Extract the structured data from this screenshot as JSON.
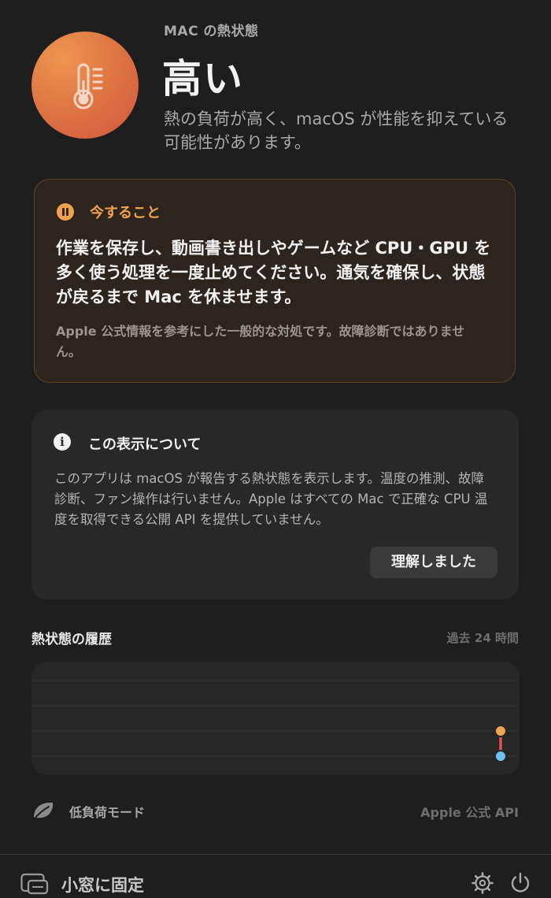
{
  "header": {
    "eyebrow": "MAC の熱状態",
    "status": "高い",
    "description": "熱の負荷が高く、macOS が性能を抑えている可能性があります。",
    "icon": "thermometer-icon",
    "accent": "#e07a44"
  },
  "action_card": {
    "heading": "今すること",
    "icon": "pause-circle-icon",
    "body": "作業を保存し、動画書き出しやゲームなど CPU・GPU を多く使う処理を一度止めてください。通気を確保し、状態が戻るまで Mac を休ませます。",
    "note": "Apple 公式情報を参考にした一般的な対処です。故障診断ではありません。",
    "accent": "#f0a24e"
  },
  "info_card": {
    "heading": "この表示について",
    "icon": "info-circle-icon",
    "body": "このアプリは macOS が報告する熱状態を表示します。温度の推測、故障診断、ファン操作は行いません。Apple はすべての Mac で正確な CPU 温度を取得できる公開 API を提供していません。",
    "button_label": "理解しました"
  },
  "history": {
    "title": "熱状態の履歴",
    "range": "過去 24 時間"
  },
  "chart_data": {
    "type": "line",
    "levels": 4,
    "series": [
      {
        "values": [
          1,
          1
        ],
        "color": "#e07a44"
      }
    ],
    "current_value": 2,
    "marker_colors": {
      "current": "#f0a24e",
      "previous": "#6ec1ec"
    },
    "grid": true
  },
  "footer": {
    "low_power_label": "低負荷モード",
    "low_power_icon": "leaf-icon",
    "source_label": "Apple 公式 API"
  },
  "bottom_bar": {
    "pin_label": "小窓に固定",
    "pin_icon": "window-pin-icon",
    "settings_icon": "gear-icon",
    "quit_icon": "power-icon"
  }
}
